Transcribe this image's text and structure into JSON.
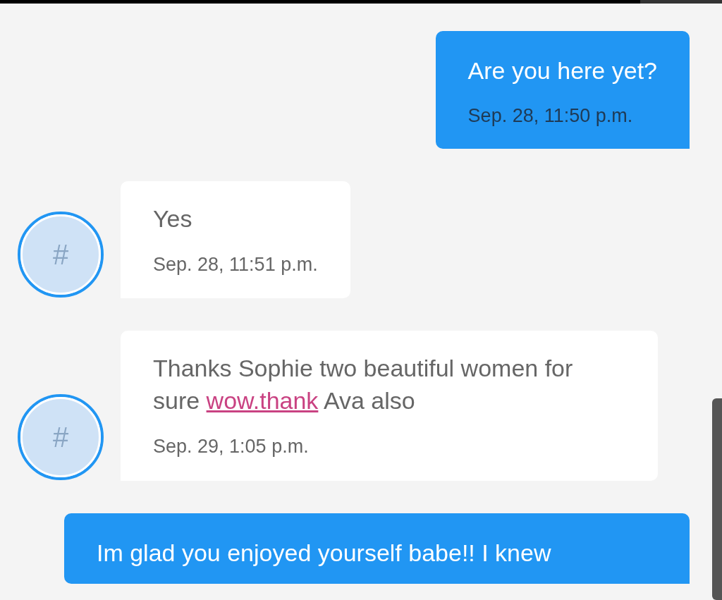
{
  "messages": [
    {
      "kind": "outgoing",
      "parts": [
        {
          "kind": "text",
          "text": "Are you here yet?"
        }
      ],
      "time": "Sep. 28, 11:50 p.m."
    },
    {
      "kind": "incoming",
      "avatar": "#",
      "parts": [
        {
          "kind": "text",
          "text": "Yes"
        }
      ],
      "time": "Sep. 28, 11:51 p.m."
    },
    {
      "kind": "incoming",
      "avatar": "#",
      "parts": [
        {
          "kind": "text",
          "text": "Thanks Sophie two beautiful women for sure "
        },
        {
          "kind": "link",
          "text": "wow.thank"
        },
        {
          "kind": "text",
          "text": " Ava also"
        }
      ],
      "time": "Sep. 29, 1:05 p.m."
    },
    {
      "kind": "outgoing",
      "parts": [
        {
          "kind": "text",
          "text": "Im glad you enjoyed yourself babe!! I knew"
        }
      ]
    }
  ]
}
